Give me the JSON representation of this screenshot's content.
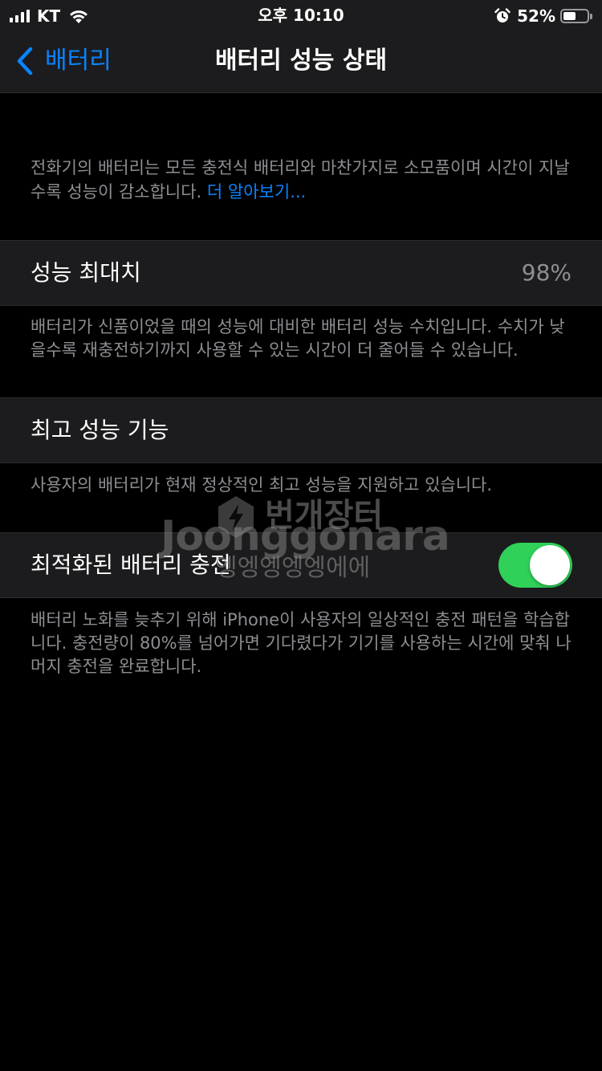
{
  "status_bar": {
    "carrier": "KT",
    "time": "오후 10:10",
    "battery_percent": "52%",
    "battery_level": 0.52,
    "icons": [
      "signal-icon",
      "wifi-icon",
      "alarm-icon",
      "battery-icon"
    ]
  },
  "nav": {
    "back_label": "배터리",
    "title": "배터리 성능 상태"
  },
  "intro": {
    "text": "전화기의 배터리는 모든 충전식 배터리와 마찬가지로 소모품이며 시간이 지날수록 성능이 감소합니다.",
    "link": "더 알아보기..."
  },
  "sections": {
    "max_capacity": {
      "label": "성능 최대치",
      "value": "98%",
      "footer": "배터리가 신품이었을 때의 성능에 대비한 배터리 성능 수치입니다. 수치가 낮을수록 재충전하기까지 사용할 수 있는 시간이 더 줄어들 수 있습니다."
    },
    "peak_performance": {
      "label": "최고 성능 기능",
      "footer": "사용자의 배터리가 현재 정상적인 최고 성능을 지원하고 있습니다."
    },
    "optimized_charging": {
      "label": "최적화된 배터리 충전",
      "toggle_on": true,
      "footer": "배터리 노화를 늦추기 위해 iPhone이 사용자의 일상적인 충전 패턴을 학습합니다. 충전량이 80%를 넘어가면 기다렸다가 기기를 사용하는 시간에 맞춰 나머지 충전을 완료합니다."
    }
  },
  "watermark": {
    "brand_ko": "번개장터",
    "brand_en": "Joonggonara",
    "sub": "엥엥엥엥엥에에"
  },
  "colors": {
    "accent": "#0a84ff",
    "toggle_on": "#30d158",
    "background": "#000000",
    "cell_bg": "#1c1c1e",
    "secondary_text": "#8e8e93"
  }
}
